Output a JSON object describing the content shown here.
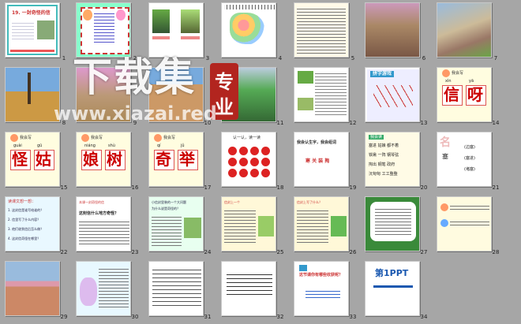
{
  "slide_numbers": [
    "1",
    "2",
    "3",
    "4",
    "5",
    "6",
    "7",
    "8",
    "9",
    "10",
    "11",
    "12",
    "13",
    "14",
    "15",
    "16",
    "17",
    "18",
    "19",
    "20",
    "21",
    "22",
    "23",
    "24",
    "25",
    "26",
    "27",
    "28",
    "29",
    "30",
    "31",
    "32",
    "33",
    "34"
  ],
  "s1": {
    "title": "19. 一封奇怪的信"
  },
  "s6": {
    "text": "我来当小导游"
  },
  "s12": {
    "title": "拼字游戏"
  },
  "s14": {
    "hdr": "我会写",
    "py1": "xìn",
    "py2": "yā",
    "c1": "信",
    "c2": "呀"
  },
  "s15": {
    "hdr": "我会写",
    "py1": "guài",
    "py2": "gū",
    "c1": "怪",
    "c2": "姑"
  },
  "s16": {
    "hdr": "我会写",
    "py1": "niáng",
    "py2": "shù",
    "c1": "娘",
    "c2": "树"
  },
  "s17": {
    "hdr": "我会写",
    "py1": "qí",
    "py2": "jǔ",
    "c1": "奇",
    "c2": "举"
  },
  "s18": {
    "title": "认一认，读一读"
  },
  "s19": {
    "line1": "我会认生字，我会组词",
    "line2": "寒 关 装 掏"
  },
  "s20": {
    "hdr": "我会读",
    "l1": "塞进  姑娘  都不着",
    "l2": "铁锹  一阵  钢琴弦",
    "l3": "掏出  钢笔  政府",
    "l4": "沉甸甸  工工整整"
  },
  "s21": {
    "c": "名",
    "c2": "塞",
    "r1": "(边塞)",
    "r2": "(塞进)",
    "r3": "(堵塞)"
  },
  "s22": {
    "title": "读课文想一想：",
    "l1": "1. 这封信是谁写给谁的？",
    "l2": "2. 信里写了什么内容？",
    "l3": "3. 他们收到信后怎么做？",
    "l4": "4. 这封信奇怪在哪里？"
  },
  "s23": {
    "l1": "本课一封奇怪的信",
    "l2": "这封信什么地方奇怪？"
  },
  "s24": {
    "l1": "小信封里装的一个大问题",
    "l2": "为什么说是奇怪的？"
  },
  "s25": {
    "l1": "信封上一个"
  },
  "s26": {
    "l1": "信封上写了什么？"
  },
  "s33": {
    "l1": "这节课你有哪些收获呢？"
  },
  "s34": {
    "l1": "第1PPT"
  },
  "watermark": {
    "big": "下载集",
    "badge1": "专",
    "badge2": "业",
    "url": "www.xiazai.red"
  }
}
